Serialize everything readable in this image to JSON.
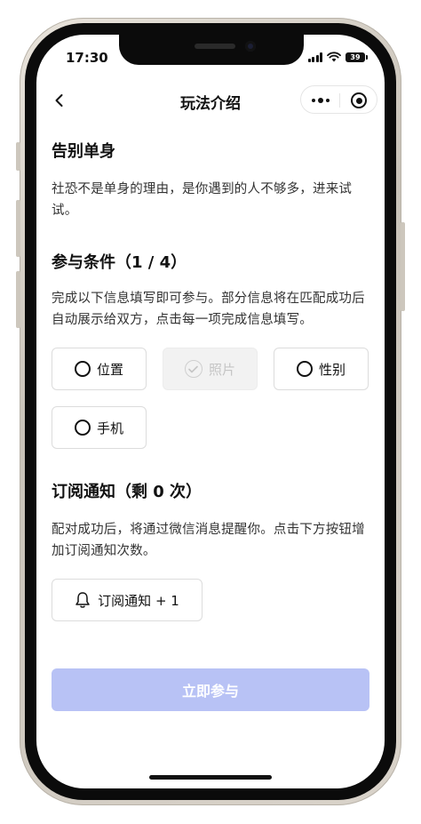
{
  "status_bar": {
    "time": "17:30",
    "battery": "39"
  },
  "nav": {
    "title": "玩法介绍"
  },
  "intro": {
    "title": "告别单身",
    "text": "社恐不是单身的理由，是你遇到的人不够多，进来试试。"
  },
  "conditions": {
    "title": "参与条件（1 / 4）",
    "text": "完成以下信息填写即可参与。部分信息将在匹配成功后自动展示给双方，点击每一项完成信息填写。",
    "items": [
      {
        "label": "位置",
        "done": false
      },
      {
        "label": "照片",
        "done": true
      },
      {
        "label": "性别",
        "done": false
      },
      {
        "label": "手机",
        "done": false
      }
    ]
  },
  "subscribe": {
    "title": "订阅通知（剩 0 次）",
    "text": "配对成功后，将通过微信消息提醒你。点击下方按钮增加订阅通知次数。",
    "button_label": "订阅通知 + 1"
  },
  "action": {
    "join_label": "立即参与"
  },
  "colors": {
    "join_button": "#b8c2f5",
    "text": "#111111",
    "border": "#dcdcdc"
  }
}
